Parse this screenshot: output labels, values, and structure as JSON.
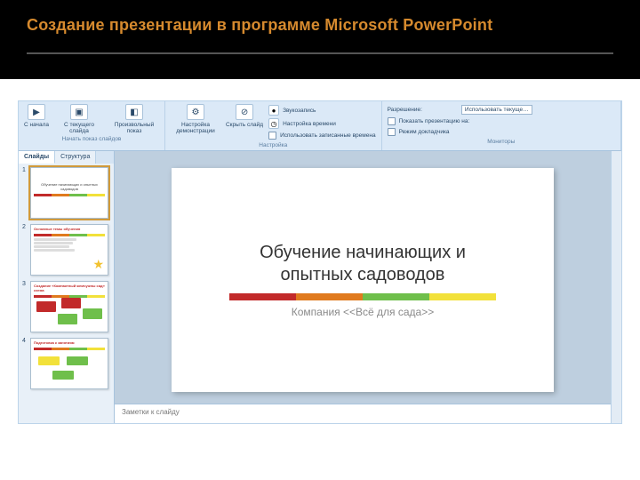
{
  "page": {
    "title": "Создание презентации в программе Microsoft PowerPoint"
  },
  "ribbon": {
    "group1": {
      "btn1": "С начала",
      "btn2": "С текущего слайда",
      "btn3": "Произвольный показ",
      "title": "Начать показ слайдов"
    },
    "group2": {
      "btn1": "Настройка демонстрации",
      "btn2": "Скрыть слайд",
      "chk1": "Звукозапись",
      "chk2": "Настройка времени",
      "chk3": "Использовать записанные времена",
      "title": "Настройка"
    },
    "group3": {
      "label1": "Разрешение:",
      "select1": "Использовать текуще…",
      "chk1": "Показать презентацию на:",
      "chk2": "Режим докладчика",
      "title": "Мониторы"
    }
  },
  "sidepane": {
    "tab1": "Слайды",
    "tab2": "Структура",
    "thumbs": [
      {
        "num": "1",
        "title": "Обучение начинающих и опытных садоводов"
      },
      {
        "num": "2",
        "title": "Основные темы обучения"
      },
      {
        "num": "3",
        "title": "Создание «Компактный жемчужны сад» схема"
      },
      {
        "num": "4",
        "title": "Подготовка к занятиям"
      }
    ]
  },
  "slide": {
    "title_line1": "Обучение начинающих и",
    "title_line2": "опытных садоводов",
    "subtitle": "Компания <<Всё для сада>>",
    "colors": {
      "red": "#c22a2a",
      "orange": "#e07a1e",
      "green": "#6fbf4b",
      "yellow": "#f2e13a"
    }
  },
  "notes": {
    "placeholder": "Заметки к слайду"
  }
}
